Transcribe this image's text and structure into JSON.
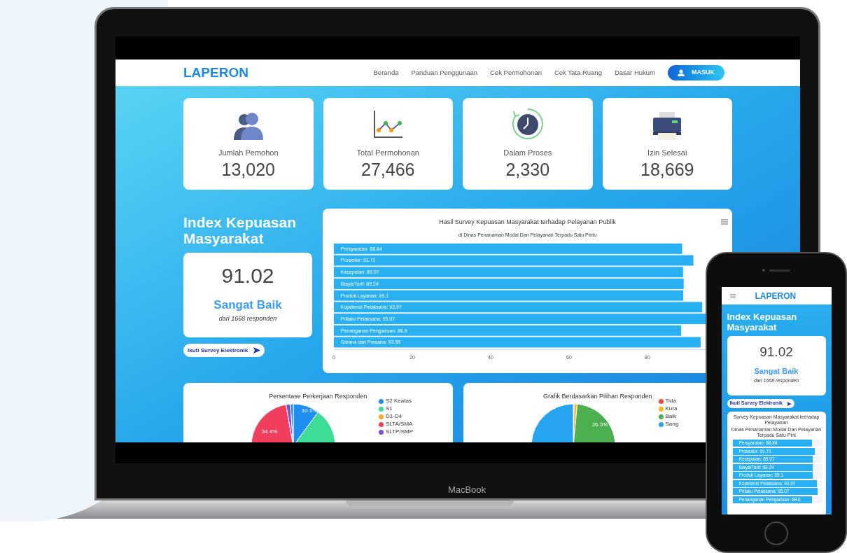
{
  "laptop": {
    "brand": "MacBook"
  },
  "navbar": {
    "logo": "LAPERON",
    "links": [
      "Beranda",
      "Panduan Penggunaan",
      "Cek Permohonan",
      "Cek Tata Ruang",
      "Dasar Hukum"
    ],
    "login_button": "MASUK"
  },
  "stats": [
    {
      "kind": "users",
      "label": "Jumlah Pemohon",
      "value": "13,020"
    },
    {
      "kind": "chart",
      "label": "Total Permohonan",
      "value": "27,466"
    },
    {
      "kind": "clock",
      "label": "Dalam Proses",
      "value": "2,330"
    },
    {
      "kind": "printer",
      "label": "Izin Selesai",
      "value": "18,669"
    }
  ],
  "index": {
    "title": "Index Kepuasan Masyarakat",
    "score": "91.02",
    "rating": "Sangat Baik",
    "respondents": "dari 1668 responden",
    "survey_button": "Ikuti Survey Elektronik"
  },
  "survey_chart": {
    "title": "Hasil Survey Kepuasan Masyarakat terhadap Pelayanan Publik",
    "subtitle": "di Dinas Penanaman Modal Dan Pelayanan Terpadu Satu Pintu",
    "chart_data": {
      "type": "bar",
      "orientation": "horizontal",
      "categories": [
        "Persyaratan: 88.84",
        "Prosedur: 91.71",
        "Kecepatan: 89.07",
        "Biaya/Tarif: 89.24",
        "Produk Layanan: 89.1",
        "Kopetensi Pelaksana: 93.97",
        "Prilaku Pelaksana: 95.07",
        "Penanganan Pengaduan: 88.6",
        "Sarana dan Prasana: 93.55"
      ],
      "values": [
        88.84,
        91.71,
        89.07,
        89.24,
        89.1,
        93.97,
        95.07,
        88.6,
        93.55
      ],
      "xticks": [
        0,
        20,
        40,
        60,
        80
      ],
      "xlim": [
        0,
        100
      ]
    }
  },
  "pie_charts": [
    {
      "title": "Persentase Perkerjaan Responden",
      "slice_labels": [
        "10.1%",
        "34.4%"
      ],
      "legend": [
        {
          "label": "S2 Keatas",
          "color": "#1e8ff0"
        },
        {
          "label": "S1",
          "color": "#3ddc97"
        },
        {
          "label": "D1-D4",
          "color": "#f7a928"
        },
        {
          "label": "SLTA/SMA",
          "color": "#f03e5c"
        },
        {
          "label": "SLTP/SMP",
          "color": "#7552d6"
        }
      ]
    },
    {
      "title": "Grafik Berdasarkan Pilihan Responden",
      "slice_labels": [
        "26.3%"
      ],
      "legend": [
        {
          "label": "Tida",
          "color": "#f04c3e"
        },
        {
          "label": "Kura",
          "color": "#f7b928"
        },
        {
          "label": "Baik",
          "color": "#4caf50"
        },
        {
          "label": "Sang",
          "color": "#26a4ef"
        }
      ]
    }
  ],
  "phone": {
    "logo": "LAPERON",
    "index": {
      "title": "Index Kepuasan Masyarakat",
      "score": "91.02",
      "rating": "Sangat Baik",
      "respondents": "dari 1668 responden",
      "survey_button": "Ikuti Survey Elektronik"
    },
    "survey_chart": {
      "title": "Survey Kepuasan Masyarakat terhadap Pelayanan",
      "subtitle": "Dinas Penanaman Modal Dan Pelayanan Terpadu Satu Pint",
      "bars": [
        {
          "label": "Persyaratan: 88.84",
          "level": 0.8884
        },
        {
          "label": "Prosedur: 91.71",
          "level": 0.9171
        },
        {
          "label": "Kecepatan: 89.07",
          "level": 0.8907
        },
        {
          "label": "Biaya/Tarif: 89.24",
          "level": 0.8924
        },
        {
          "label": "Produk Layanan: 89.1",
          "level": 0.891
        },
        {
          "label": "Kopetensi Pelaksana: 93.97",
          "level": 0.9397
        },
        {
          "label": "Prilaku Pelaksana: 95.07",
          "level": 0.9507
        },
        {
          "label": "Penanganan Pengaduan: 88.6",
          "level": 0.886
        }
      ]
    }
  }
}
